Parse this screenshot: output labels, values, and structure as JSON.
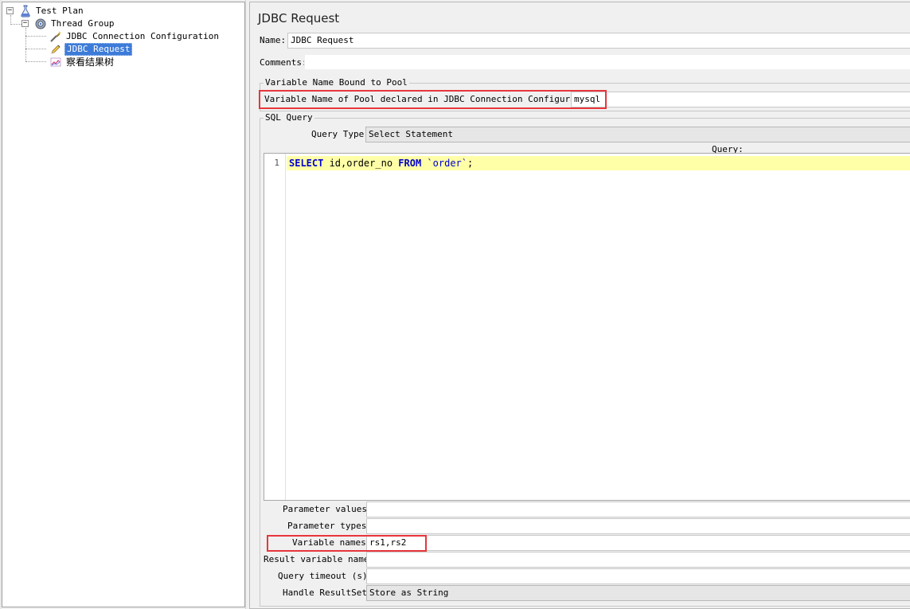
{
  "tree": {
    "test_plan": "Test Plan",
    "thread_group": "Thread Group",
    "jdbc_connection": "JDBC Connection Configuration",
    "jdbc_request": "JDBC Request",
    "result_tree": "察看结果树"
  },
  "panel": {
    "title": "JDBC Request",
    "name_label": "Name:",
    "name_value": "JDBC Request",
    "comments_label": "Comments:",
    "comments_value": "",
    "pool_section": "Variable Name Bound to Pool",
    "pool_label": "Variable Name of Pool declared in JDBC Connection Configuration:",
    "pool_value": "mysql",
    "sql_section": "SQL Query",
    "query_type_label": "Query Type:",
    "query_type_value": "Select Statement",
    "query_label": "Query:",
    "line_number": "1",
    "query_tokens": {
      "select": "SELECT",
      "columns": " id,order_no ",
      "from": "FROM",
      "space": " ",
      "table": "`order`",
      "semi": ";"
    },
    "param_values_label": "Parameter values:",
    "param_values_value": "",
    "param_types_label": "Parameter types:",
    "param_types_value": "",
    "var_names_label": "Variable names:",
    "var_names_value": "rs1,rs2",
    "result_var_label": "Result variable name:",
    "result_var_value": "",
    "timeout_label": "Query timeout (s):",
    "timeout_value": "",
    "handle_label": "Handle ResultSet:",
    "handle_value": "Store as String"
  },
  "icons": {
    "test_plan": "flask-icon",
    "thread_group": "gear-icon",
    "jdbc_connection": "wrench-icon",
    "jdbc_request": "pencil-icon",
    "result_tree": "chart-icon"
  },
  "colors": {
    "highlight_border": "#e8363c",
    "selection": "#3d7bd8",
    "current_line": "#ffffa8",
    "sql_keyword": "#0000cc"
  }
}
